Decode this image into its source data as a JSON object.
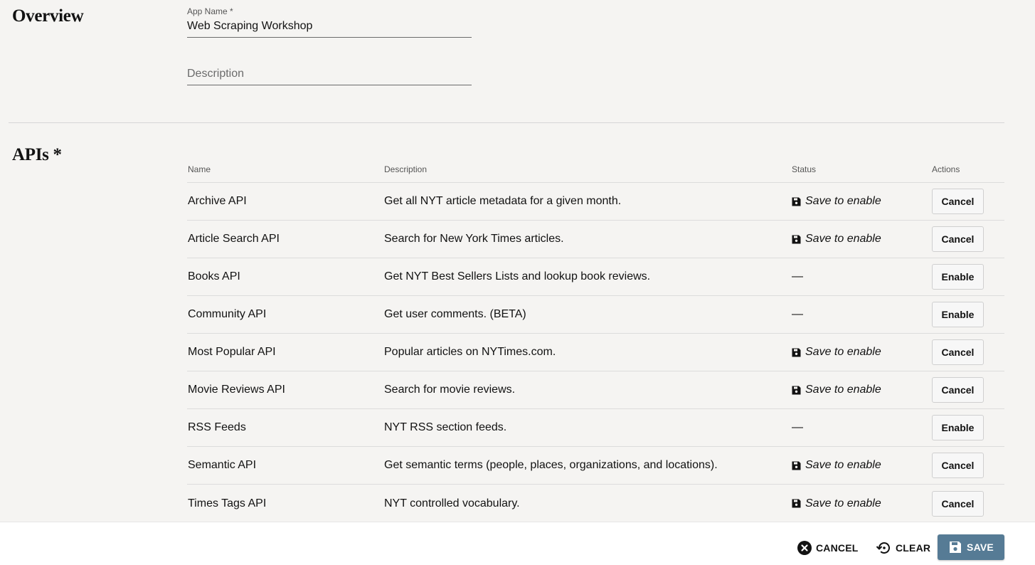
{
  "overview": {
    "title": "Overview",
    "app_name_label": "App Name *",
    "app_name_value": "Web Scraping Workshop",
    "description_placeholder": "Description"
  },
  "apis": {
    "title": "APIs *",
    "columns": {
      "name": "Name",
      "description": "Description",
      "status": "Status",
      "actions": "Actions"
    },
    "rows": [
      {
        "name": "Archive API",
        "description": "Get all NYT article metadata for a given month.",
        "status": "Save to enable",
        "status_icon": "floppy-disk-icon",
        "action": "Cancel"
      },
      {
        "name": "Article Search API",
        "description": "Search for New York Times articles.",
        "status": "Save to enable",
        "status_icon": "floppy-disk-icon",
        "action": "Cancel"
      },
      {
        "name": "Books API",
        "description": "Get NYT Best Sellers Lists and lookup book reviews.",
        "status": "—",
        "status_icon": "",
        "action": "Enable"
      },
      {
        "name": "Community API",
        "description": "Get user comments. (BETA)",
        "status": "—",
        "status_icon": "",
        "action": "Enable"
      },
      {
        "name": "Most Popular API",
        "description": "Popular articles on NYTimes.com.",
        "status": "Save to enable",
        "status_icon": "floppy-disk-icon",
        "action": "Cancel"
      },
      {
        "name": "Movie Reviews API",
        "description": "Search for movie reviews.",
        "status": "Save to enable",
        "status_icon": "floppy-disk-icon",
        "action": "Cancel"
      },
      {
        "name": "RSS Feeds",
        "description": "NYT RSS section feeds.",
        "status": "—",
        "status_icon": "",
        "action": "Enable"
      },
      {
        "name": "Semantic API",
        "description": "Get semantic terms (people, places, organizations, and locations).",
        "status": "Save to enable",
        "status_icon": "floppy-disk-icon",
        "action": "Cancel"
      },
      {
        "name": "Times Tags API",
        "description": "NYT controlled vocabulary.",
        "status": "Save to enable",
        "status_icon": "floppy-disk-icon",
        "action": "Cancel"
      }
    ]
  },
  "footer": {
    "cancel_label": "CANCEL",
    "clear_label": "CLEAR",
    "save_label": "SAVE"
  },
  "colors": {
    "page_background": "#f5f4f2",
    "save_button": "#567b95",
    "text": "#121212"
  }
}
